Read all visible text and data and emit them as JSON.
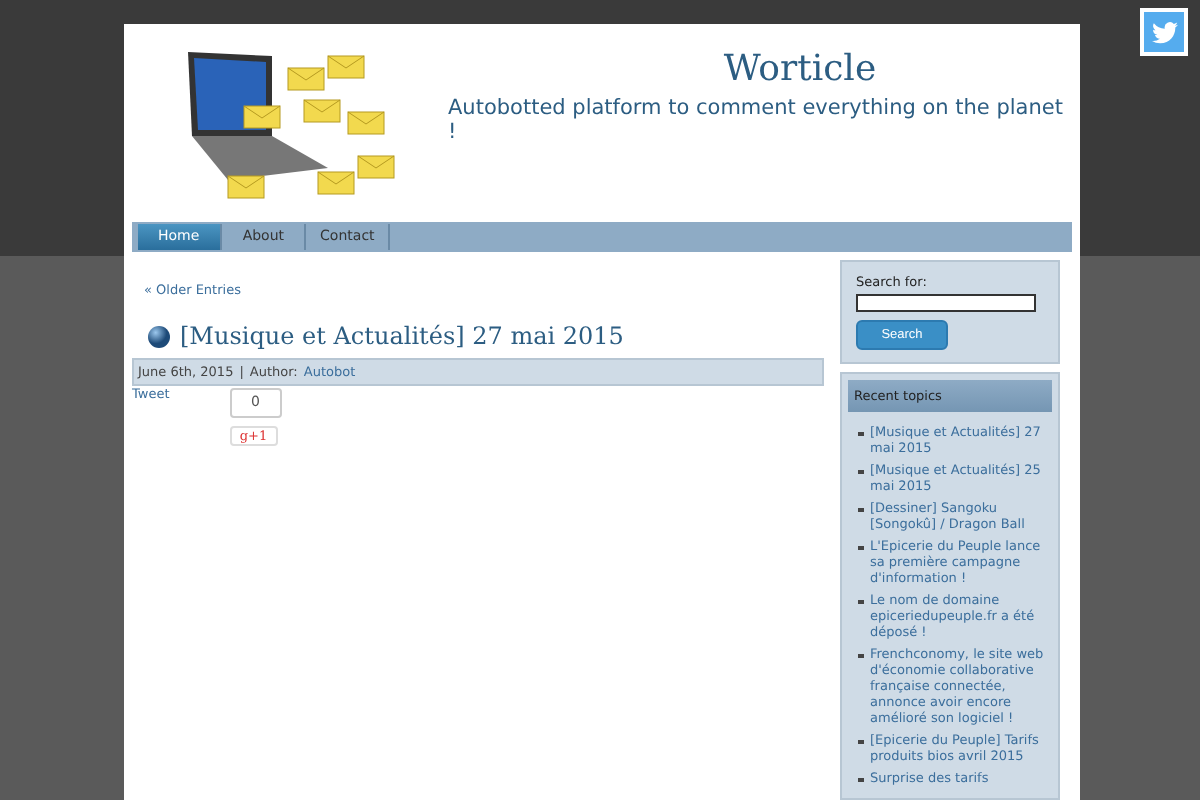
{
  "header": {
    "title": "Worticle",
    "tagline": "Autobotted platform to comment everything on the planet !"
  },
  "nav": [
    {
      "label": "Home",
      "selected": true
    },
    {
      "label": "About",
      "selected": false
    },
    {
      "label": "Contact",
      "selected": false
    }
  ],
  "content": {
    "older_link": "« Older Entries",
    "post": {
      "title": "[Musique et Actualités] 27 mai 2015",
      "meta_date": "June 6th, 2015",
      "meta_sep": "|",
      "meta_author_label": "Author:",
      "meta_author": "Autobot",
      "tweet": "Tweet",
      "share_count": "0",
      "gplus": "g+1"
    }
  },
  "sidebar": {
    "search_label": "Search for:",
    "search_button": "Search",
    "recent_title": "Recent topics",
    "recent": [
      "[Musique et Actualités] 27 mai 2015",
      "[Musique et Actualités] 25 mai 2015",
      "[Dessiner] Sangoku [Songokû] / Dragon Ball",
      "L'Epicerie du Peuple lance sa première campagne d'information !",
      "Le nom de domaine epiceriedupeuple.fr a été déposé !",
      "Frenchconomy, le site web d'économie collaborative française connectée, annonce avoir encore amélioré son logiciel !",
      "[Epicerie du Peuple] Tarifs produits bios avril 2015",
      "Surprise des tarifs"
    ]
  }
}
